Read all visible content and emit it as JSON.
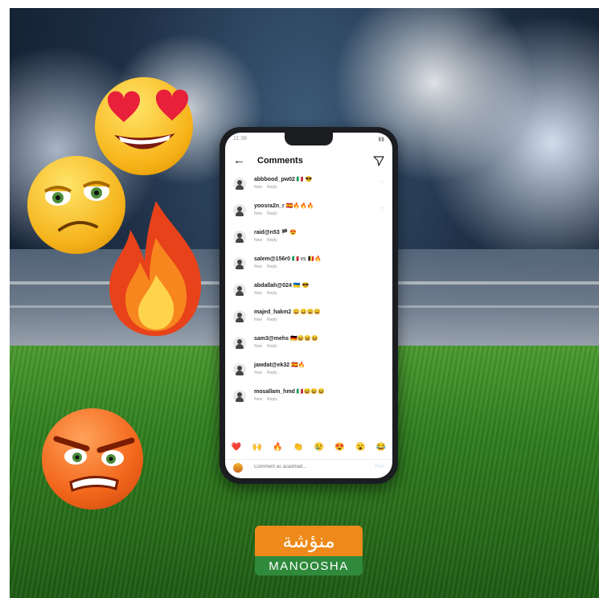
{
  "status_bar": {
    "time": "11:38"
  },
  "header": {
    "title": "Comments"
  },
  "comments": [
    {
      "username": "abbbood_pw02",
      "emojis": "🇮🇹 😎",
      "time": "Now",
      "reply": "Reply"
    },
    {
      "username": "yoosra2n_r",
      "emojis": "🇪🇸🔥🔥🔥",
      "time": "Now",
      "reply": "Reply"
    },
    {
      "username": "raid@n53",
      "emojis": "🏴 😍",
      "time": "Now",
      "reply": "Reply"
    },
    {
      "username": "salem@156r0",
      "emojis": "🇮🇹 vs 🇧🇪🔥",
      "time": "Now",
      "reply": "Reply"
    },
    {
      "username": "abdallah@024",
      "emojis": "🇺🇦 😎",
      "time": "Now",
      "reply": "Reply"
    },
    {
      "username": "majed_hakm2",
      "emojis": "😀😀😀😀",
      "time": "Now",
      "reply": "Reply"
    },
    {
      "username": "sam3@mehs",
      "emojis": "🇩🇪😆😆😆",
      "time": "Now",
      "reply": "Reply"
    },
    {
      "username": "jawdat@ek32",
      "emojis": "🇪🇸🔥",
      "time": "Now",
      "reply": "Reply"
    },
    {
      "username": "mosallam_hmd",
      "emojis": "🇮🇹😆😆😆",
      "time": "Now",
      "reply": "Reply"
    }
  ],
  "reactions": [
    "❤️",
    "🙌",
    "🔥",
    "👏",
    "😢",
    "😍",
    "😮",
    "😂"
  ],
  "input": {
    "placeholder": "Comment as acadmad...",
    "post_label": "Post"
  },
  "logo": {
    "arabic": "منؤشة",
    "latin": "MANOOSHA"
  },
  "colors": {
    "logo_orange": "#ee8a1a",
    "logo_green": "#2f8a3c"
  }
}
